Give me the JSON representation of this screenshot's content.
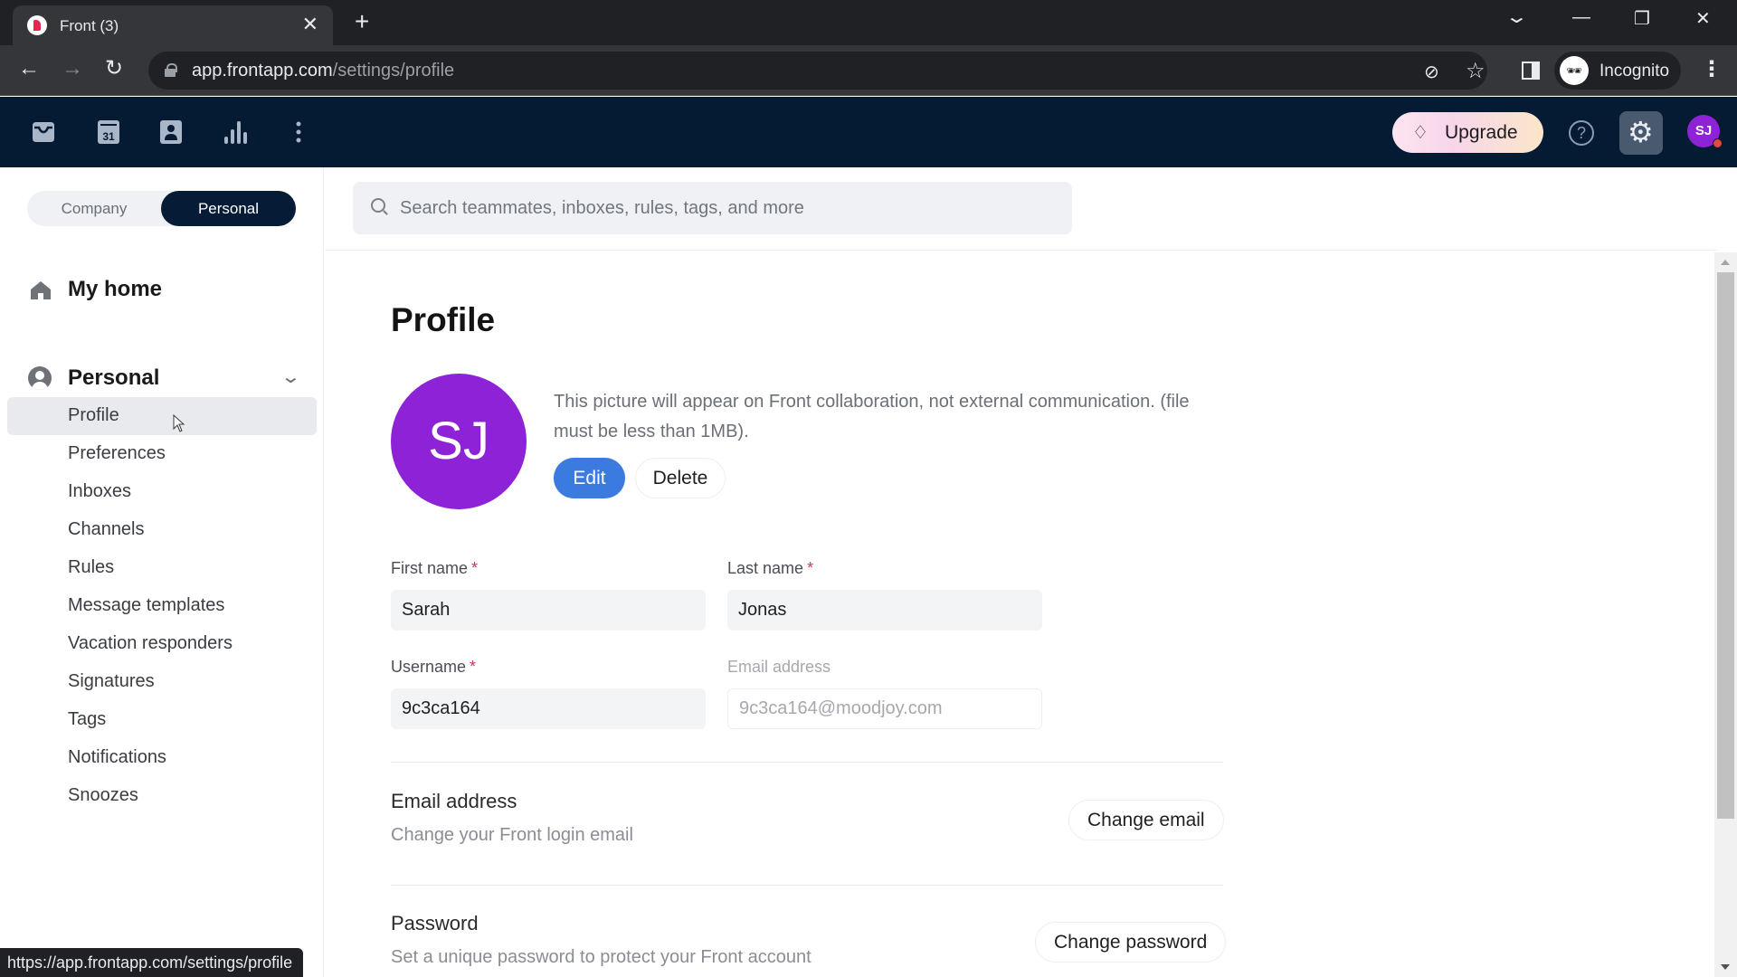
{
  "browser": {
    "tab_title": "Front (3)",
    "url_host": "app.frontapp.com",
    "url_path": "/settings/profile",
    "profile_label": "Incognito",
    "status_url": "https://app.frontapp.com/settings/profile",
    "icons": {
      "close": "✕",
      "new_tab": "+",
      "back": "←",
      "forward": "→",
      "reload": "↻",
      "tab_search": "⌄",
      "minimize": "—",
      "restore": "❐",
      "window_close": "✕",
      "eye_off": "⊘",
      "star": "☆",
      "incognito": "🕶",
      "menu": "⋮"
    }
  },
  "appbar": {
    "upgrade_label": "Upgrade",
    "upgrade_icon": "♢",
    "help_icon": "?",
    "settings_icon": "⚙",
    "avatar_initials": "SJ",
    "calendar_day": "31"
  },
  "sidebar": {
    "scope_tabs": [
      {
        "label": "Company",
        "active": false
      },
      {
        "label": "Personal",
        "active": true
      }
    ],
    "home_label": "My home",
    "section_label": "Personal",
    "section_chevron": "⌄",
    "items": [
      {
        "label": "Profile",
        "active": true
      },
      {
        "label": "Preferences",
        "active": false
      },
      {
        "label": "Inboxes",
        "active": false
      },
      {
        "label": "Channels",
        "active": false
      },
      {
        "label": "Rules",
        "active": false
      },
      {
        "label": "Message templates",
        "active": false
      },
      {
        "label": "Vacation responders",
        "active": false
      },
      {
        "label": "Signatures",
        "active": false
      },
      {
        "label": "Tags",
        "active": false
      },
      {
        "label": "Notifications",
        "active": false
      },
      {
        "label": "Snoozes",
        "active": false
      }
    ]
  },
  "search": {
    "placeholder": "Search teammates, inboxes, rules, tags, and more",
    "value": ""
  },
  "profile": {
    "title": "Profile",
    "avatar_initials": "SJ",
    "avatar_color": "#8e22d6",
    "picture_note": "This picture will appear on Front collaboration, not external communication. (file must be less than 1MB).",
    "edit_label": "Edit",
    "delete_label": "Delete",
    "required_mark": "*",
    "fields": {
      "first_name": {
        "label": "First name",
        "value": "Sarah",
        "required": true
      },
      "last_name": {
        "label": "Last name",
        "value": "Jonas",
        "required": true
      },
      "username": {
        "label": "Username",
        "value": "9c3ca164",
        "required": true
      },
      "email": {
        "label": "Email address",
        "value": "9c3ca164@moodjoy.com",
        "required": false,
        "disabled": true
      }
    },
    "sections": {
      "email": {
        "title": "Email address",
        "description": "Change your Front login email",
        "button": "Change email"
      },
      "password": {
        "title": "Password",
        "description": "Set a unique password to protect your Front account",
        "button": "Change password"
      }
    }
  },
  "colors": {
    "appbar_bg": "#051a33",
    "accent_blue": "#3b7be0",
    "required_red": "#d2365f",
    "avatar_purple": "#8e22d6",
    "notification_dot": "#e5483e"
  }
}
